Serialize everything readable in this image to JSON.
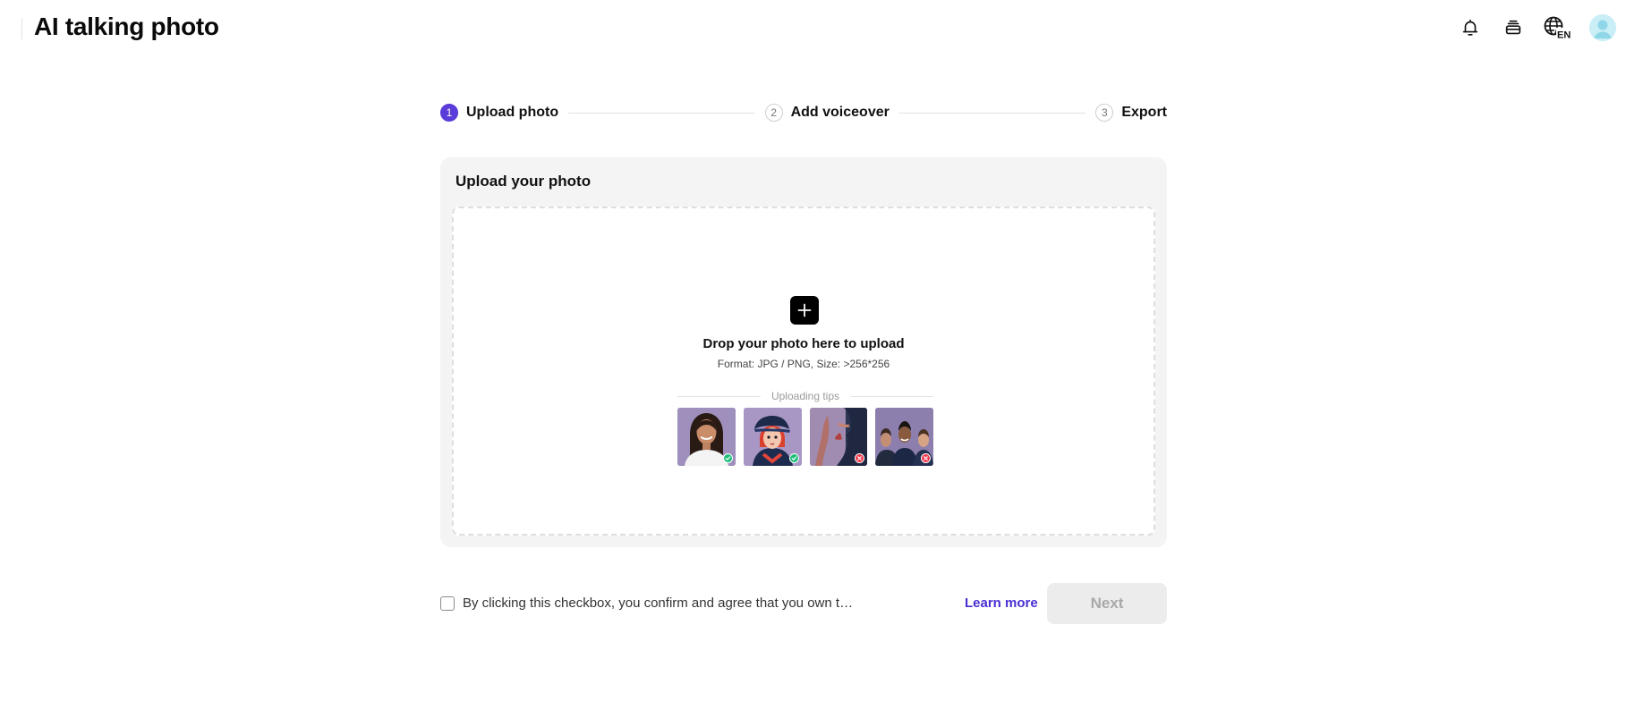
{
  "header": {
    "title": "AI talking photo",
    "language_code": "EN",
    "icons": [
      "bell-icon",
      "credits-stack-icon",
      "globe-language-icon",
      "user-avatar"
    ]
  },
  "stepper": {
    "steps": [
      {
        "number": "1",
        "label": "Upload photo",
        "active": true
      },
      {
        "number": "2",
        "label": "Add voiceover",
        "active": false
      },
      {
        "number": "3",
        "label": "Export",
        "active": false
      }
    ]
  },
  "upload": {
    "title": "Upload your photo",
    "drop_title": "Drop your photo here to upload",
    "drop_subtitle": "Format: JPG / PNG, Size: >256*256",
    "tips_label": "Uploading tips",
    "tips": [
      {
        "status": "good"
      },
      {
        "status": "good"
      },
      {
        "status": "bad"
      },
      {
        "status": "bad"
      }
    ]
  },
  "footer": {
    "consent_text": "By clicking this checkbox, you confirm and agree that you own the rights to, or hav...",
    "learn_more": "Learn more",
    "next_label": "Next",
    "next_enabled": false
  },
  "colors": {
    "accent": "#5b3bd9",
    "link": "#4a2fd4",
    "good_badge": "#1fbf7a",
    "bad_badge": "#f2364b"
  }
}
